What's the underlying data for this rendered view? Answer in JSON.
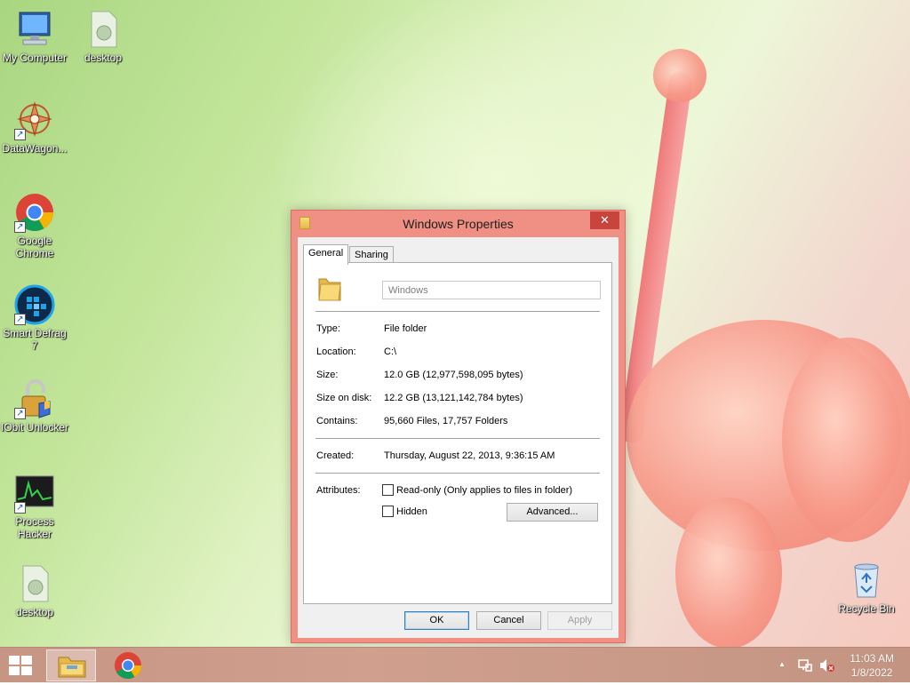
{
  "desktop_icons": [
    {
      "label": "My Computer",
      "icon": "computer-icon"
    },
    {
      "label": "desktop",
      "icon": "document-icon"
    },
    {
      "label": "DataWagon...",
      "icon": "datawagon-icon"
    },
    {
      "label": "Google Chrome",
      "icon": "chrome-icon"
    },
    {
      "label": "Smart Defrag 7",
      "icon": "smart-defrag-icon"
    },
    {
      "label": "IObit Unlocker",
      "icon": "unlocker-icon"
    },
    {
      "label": "Process Hacker",
      "icon": "process-hacker-icon"
    },
    {
      "label": "desktop",
      "icon": "document-icon"
    },
    {
      "label": "Recycle Bin",
      "icon": "recycle-bin-icon"
    }
  ],
  "dialog": {
    "title": "Windows Properties",
    "close_glyph": "✕",
    "tabs": [
      {
        "label": "General",
        "active": true
      },
      {
        "label": "Sharing",
        "active": false
      }
    ],
    "name_value": "Windows",
    "properties": [
      {
        "label": "Type:",
        "value": "File folder"
      },
      {
        "label": "Location:",
        "value": "C:\\"
      },
      {
        "label": "Size:",
        "value": "12.0 GB (12,977,598,095 bytes)"
      },
      {
        "label": "Size on disk:",
        "value": "12.2 GB (13,121,142,784 bytes)"
      },
      {
        "label": "Contains:",
        "value": "95,660 Files, 17,757 Folders"
      }
    ],
    "created": {
      "label": "Created:",
      "value": "Thursday, August 22, 2013, 9:36:15 AM"
    },
    "attributes": {
      "label": "Attributes:",
      "readonly_label": "Read-only (Only applies to files in folder)",
      "hidden_label": "Hidden",
      "advanced_label": "Advanced..."
    },
    "buttons": {
      "ok": "OK",
      "cancel": "Cancel",
      "apply": "Apply"
    }
  },
  "taskbar": {
    "time": "11:03 AM",
    "date": "1/8/2022",
    "tray_expand_glyph": "▲"
  },
  "colors": {
    "dialog_frame": "#f08f84",
    "close_button": "#c7453c",
    "taskbar": "#c79583"
  }
}
